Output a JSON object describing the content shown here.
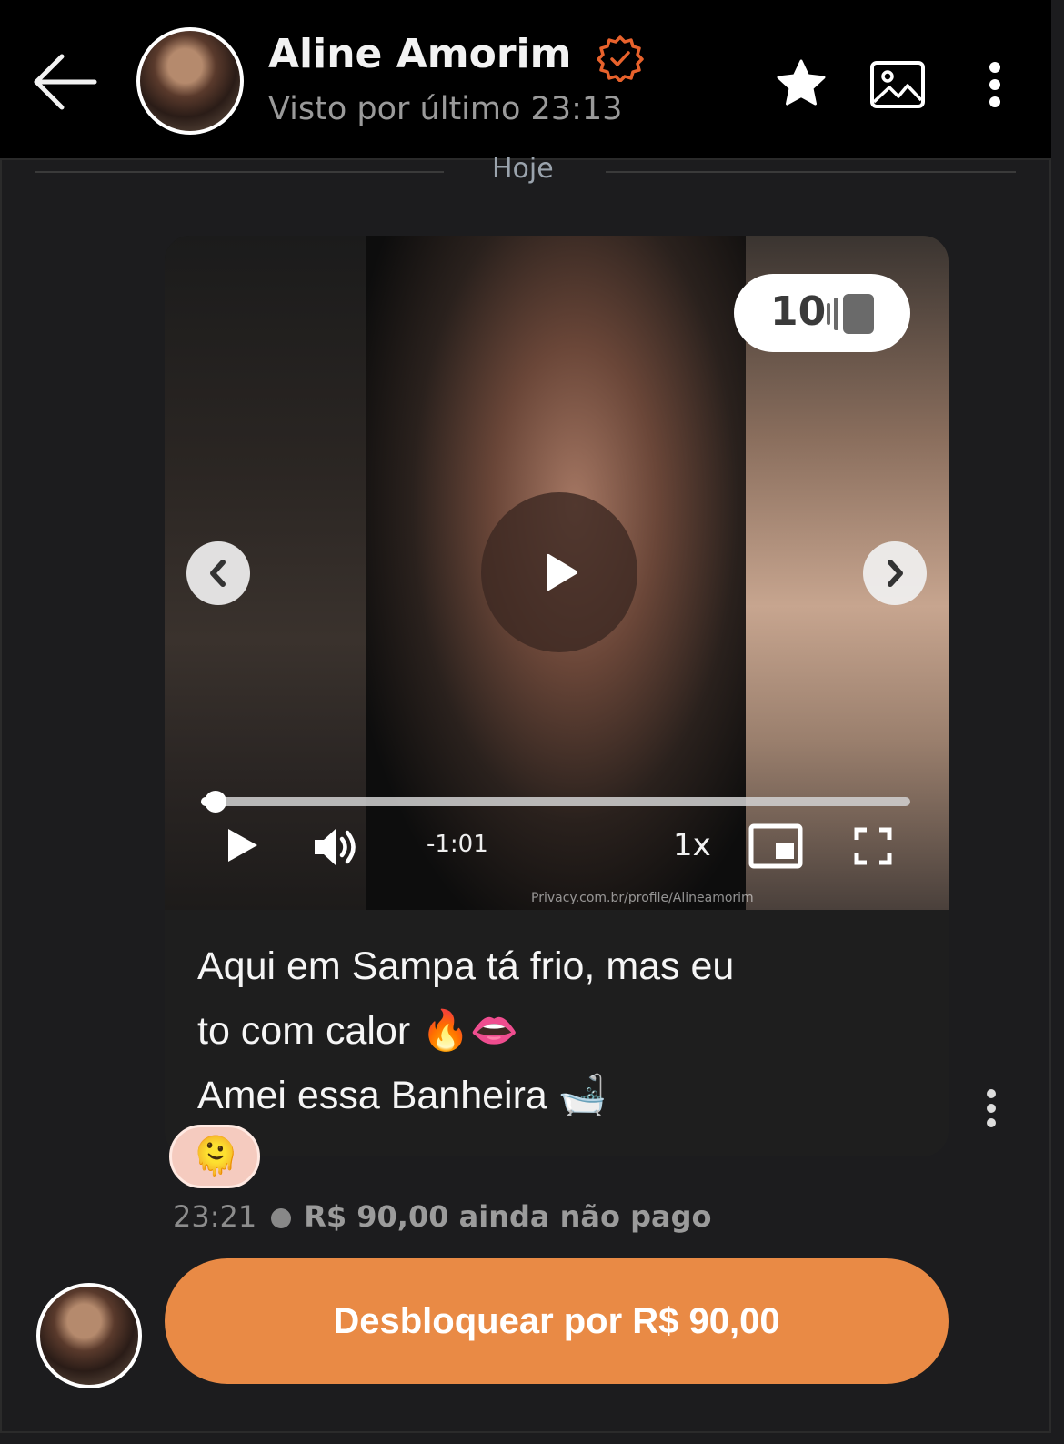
{
  "header": {
    "name": "Aline Amorim",
    "last_seen": "Visto por último 23:13",
    "verified_color": "#e8622c"
  },
  "chat": {
    "date_divider": "Hoje"
  },
  "media": {
    "count": "10",
    "time_remaining": "-1:01",
    "speed": "1x",
    "watermark": "Privacy.com.br/profile/Alineamorim",
    "progress": 0.02
  },
  "message": {
    "line1": "Aqui em Sampa tá frio, mas eu",
    "line2": "to com calor 🔥👄",
    "line3": "Amei essa Banheira 🛁",
    "reaction": "🫠",
    "time": "23:21",
    "price_status": "R$ 90,00 ainda não pago"
  },
  "unlock": {
    "label": "Desbloquear por R$ 90,00",
    "color": "#e98a45"
  }
}
